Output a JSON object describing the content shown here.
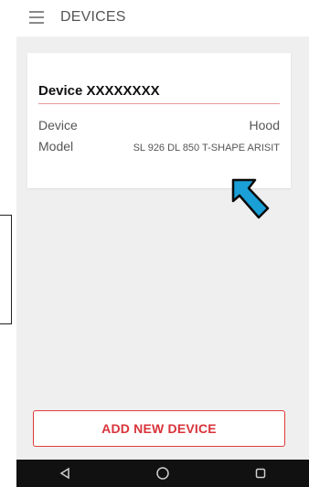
{
  "appbar": {
    "title": "DEVICES"
  },
  "device_card": {
    "title": "Device XXXXXXXX",
    "rows": [
      {
        "label": "Device",
        "value": "Hood"
      },
      {
        "label": "Model",
        "value": "SL 926 DL 850 T-SHAPE ARISIT"
      }
    ]
  },
  "actions": {
    "add_device_label": "ADD NEW DEVICE"
  },
  "colors": {
    "accent": "#d9333a",
    "annotation_arrow": "#1aa0d6",
    "background": "#efefef"
  },
  "icons": {
    "menu": "hamburger-menu-icon",
    "back": "back-triangle-icon",
    "home": "home-circle-icon",
    "recents": "recents-square-icon"
  }
}
